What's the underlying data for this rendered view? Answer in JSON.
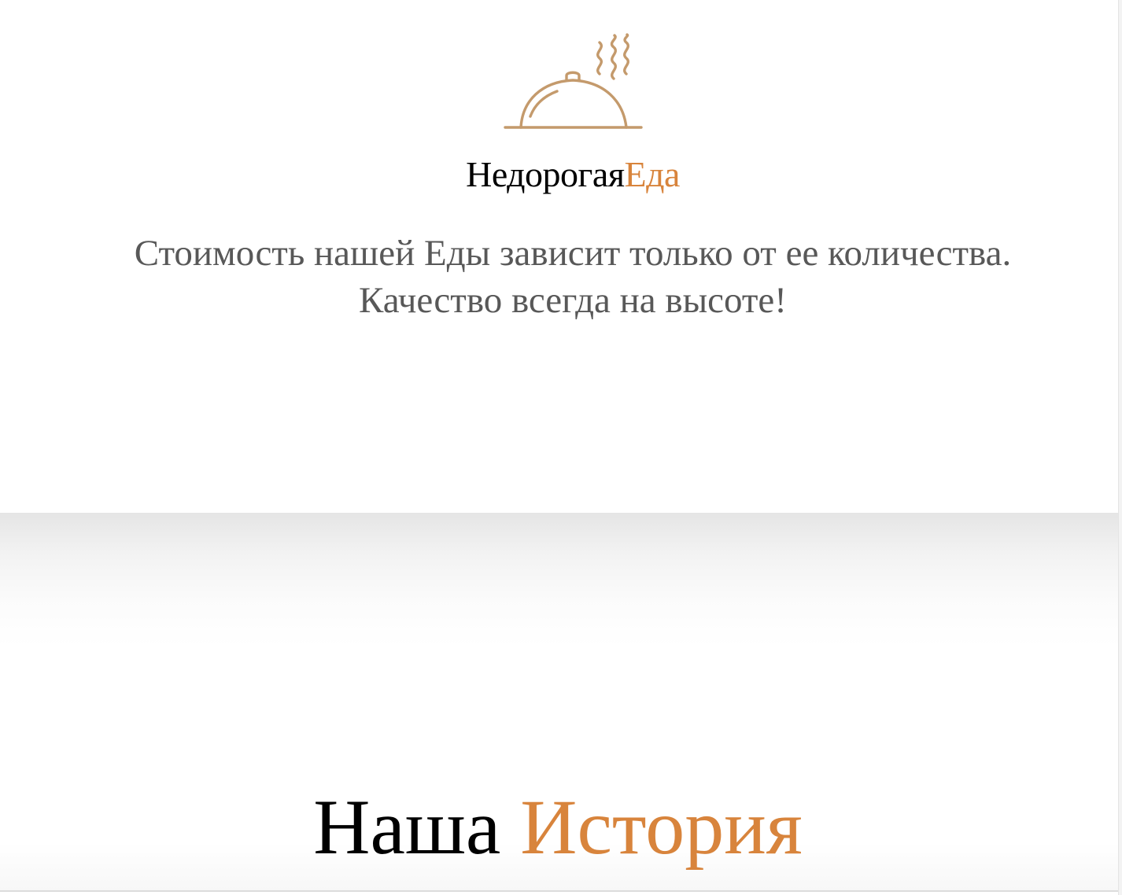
{
  "brand": {
    "part1": "Недорогая",
    "part2": "Еда",
    "logo_icon": "serving-cloche-icon",
    "accent_color": "#d8843c",
    "icon_color": "#c49a6c"
  },
  "hero": {
    "tagline_line1": "Стоимость нашей Еды зависит только от ее количества.",
    "tagline_line2": "Качество всегда на высоте!"
  },
  "history": {
    "title_part1": "Наша",
    "title_part2": "История"
  }
}
